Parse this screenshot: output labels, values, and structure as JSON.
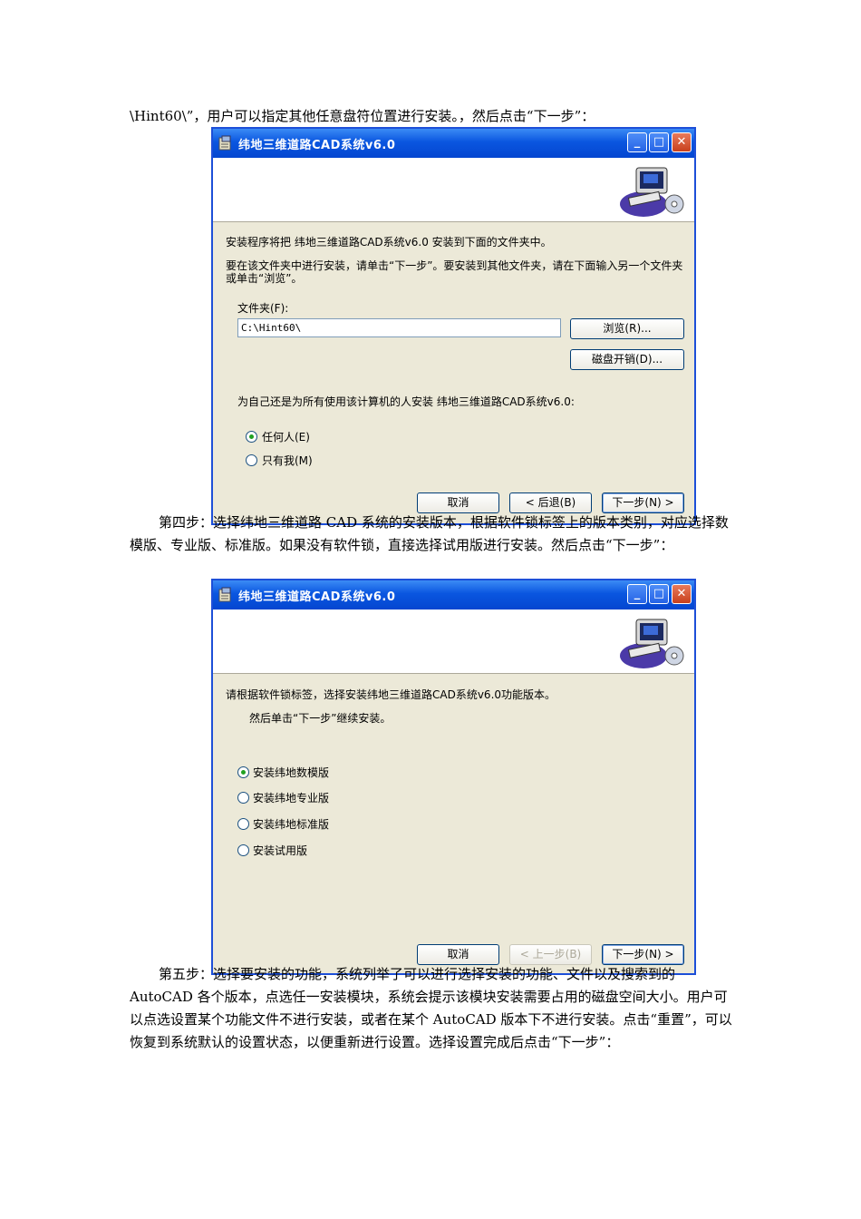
{
  "text": {
    "p1": "\\Hint60\\”，用户可以指定其他任意盘符位置进行安装。，然后点击“下一步”：",
    "p2": "第四步：选择纬地三维道路 CAD 系统的安装版本，根据软件锁标签上的版本类别，对应选择数模版、专业版、标准版。如果没有软件锁，直接选择试用版进行安装。然后点击“下一步”：",
    "p3": "第五步：选择要安装的功能，系统列举了可以进行选择安装的功能、文件以及搜索到的 AutoCAD 各个版本，点选任一安装模块，系统会提示该模块安装需要占用的磁盘空间大小。用户可以点选设置某个功能文件不进行安装，或者在某个 AutoCAD 版本下不进行安装。点击“重置”，可以恢复到系统默认的设置状态，以便重新进行设置。选择设置完成后点击“下一步”："
  },
  "dialog1": {
    "title": "纬地三维道路CAD系统v6.0",
    "intro": "安装程序将把 纬地三维道路CAD系统v6.0 安装到下面的文件夹中。",
    "instruction": "要在该文件夹中进行安装，请单击“下一步”。要安装到其他文件夹，请在下面输入另一个文件夹或单击“浏览”。",
    "folder_label": "文件夹(F):",
    "folder_value": "C:\\Hint60\\",
    "browse_button": "浏览(R)...",
    "disk_cost_button": "磁盘开销(D)...",
    "user_question": "为自己还是为所有使用该计算机的人安装 纬地三维道路CAD系统v6.0:",
    "radio_everyone": "任何人(E)",
    "radio_just_me": "只有我(M)",
    "selected": "everyone",
    "cancel_button": "取消",
    "back_button": "< 后退(B)",
    "next_button": "下一步(N) >"
  },
  "dialog2": {
    "title": "纬地三维道路CAD系统v6.0",
    "instruction1": "请根据软件锁标签，选择安装纬地三维道路CAD系统v6.0功能版本。",
    "instruction2": "然后单击“下一步”继续安装。",
    "options": [
      "安装纬地数模版",
      "安装纬地专业版",
      "安装纬地标准版",
      "安装试用版"
    ],
    "selected_index": 0,
    "cancel_button": "取消",
    "back_button": "< 上一步(B)",
    "next_button": "下一步(N) >"
  }
}
